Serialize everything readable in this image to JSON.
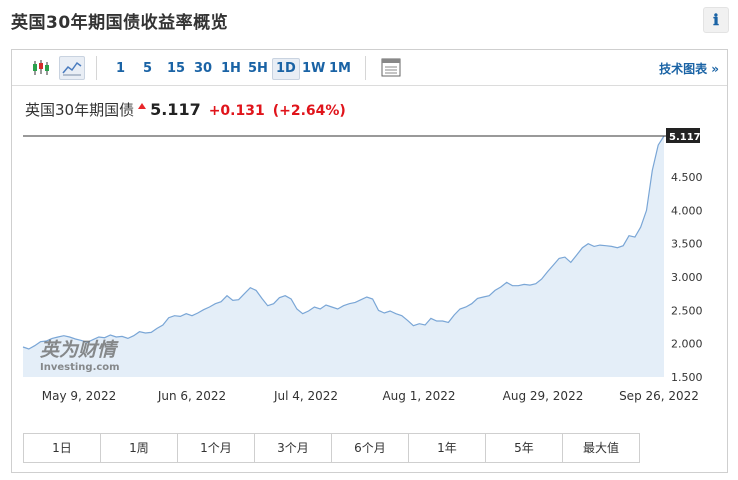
{
  "page": {
    "title": "英国30年期国债收益率概览",
    "info_icon": "ℹ"
  },
  "toolbar": {
    "periods": [
      "1",
      "5",
      "15",
      "30",
      "1H",
      "5H",
      "1D",
      "1W",
      "1M"
    ],
    "active_period": "1D",
    "tech_link": "技术图表 »"
  },
  "quote": {
    "name": "英国30年期国债",
    "price": "5.117",
    "change": "+0.131",
    "change_pct": "(+2.64%)",
    "direction": "up",
    "up_color": "#e0141b"
  },
  "watermark": {
    "brand": "英为财情",
    "sub": "Investing.com"
  },
  "chart_data": {
    "type": "area",
    "x_tick_labels": [
      "May 9, 2022",
      "Jun 6, 2022",
      "Jul 4, 2022",
      "Aug 1, 2022",
      "Aug 29, 2022",
      "Sep 26, 2022"
    ],
    "y_tick_labels": [
      "1.500",
      "2.000",
      "2.500",
      "3.000",
      "3.500",
      "4.000",
      "4.500"
    ],
    "ylim": [
      1.5,
      5.117
    ],
    "last_value": 5.117,
    "last_value_label": "5.117",
    "line_color": "#7aa6d6",
    "fill_color": "#e4eef8",
    "series": [
      {
        "values": [
          1.95,
          1.92,
          1.97,
          2.03,
          2.04,
          2.08,
          2.1,
          2.12,
          2.1,
          2.07,
          2.05,
          2.02,
          2.06,
          2.1,
          2.09,
          2.13,
          2.1,
          2.11,
          2.08,
          2.12,
          2.18,
          2.16,
          2.17,
          2.23,
          2.28,
          2.39,
          2.42,
          2.41,
          2.45,
          2.42,
          2.46,
          2.51,
          2.55,
          2.6,
          2.63,
          2.72,
          2.65,
          2.66,
          2.75,
          2.84,
          2.8,
          2.68,
          2.57,
          2.6,
          2.69,
          2.72,
          2.67,
          2.52,
          2.45,
          2.49,
          2.55,
          2.52,
          2.58,
          2.55,
          2.52,
          2.57,
          2.6,
          2.62,
          2.66,
          2.7,
          2.67,
          2.5,
          2.46,
          2.49,
          2.45,
          2.42,
          2.35,
          2.27,
          2.3,
          2.28,
          2.38,
          2.34,
          2.34,
          2.32,
          2.43,
          2.52,
          2.55,
          2.6,
          2.68,
          2.7,
          2.72,
          2.8,
          2.85,
          2.92,
          2.87,
          2.87,
          2.89,
          2.88,
          2.9,
          2.97,
          3.08,
          3.18,
          3.28,
          3.3,
          3.22,
          3.33,
          3.44,
          3.5,
          3.46,
          3.48,
          3.47,
          3.46,
          3.44,
          3.47,
          3.62,
          3.6,
          3.75,
          4.0,
          4.6,
          4.98,
          5.117
        ]
      }
    ]
  },
  "range_buttons": [
    "1日",
    "1周",
    "1个月",
    "3个月",
    "6个月",
    "1年",
    "5年",
    "最大值"
  ]
}
